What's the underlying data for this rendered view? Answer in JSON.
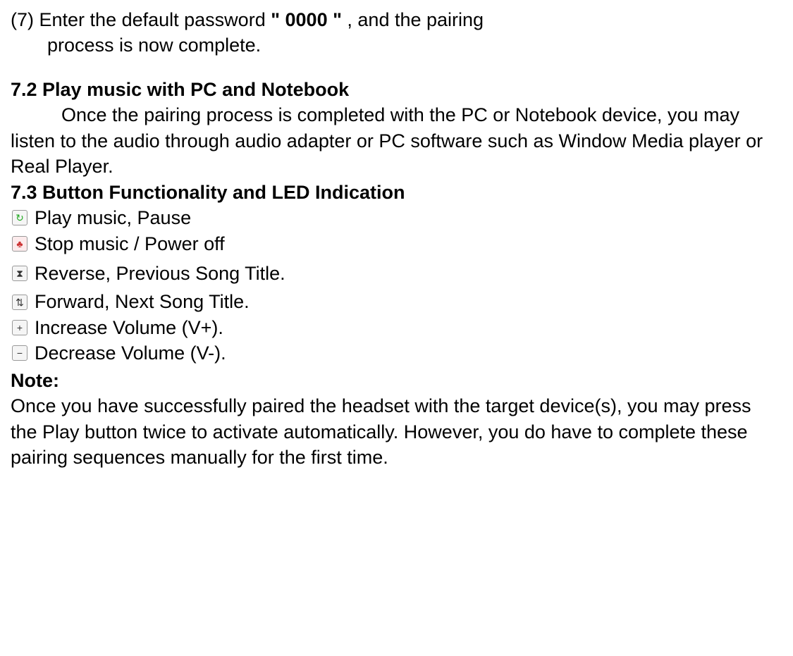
{
  "step7": {
    "num": "(7)",
    "line1_a": " Enter the default password ",
    "pw": "\" 0000 \"",
    "line1_b": ", and the pairing",
    "line2": "process is now complete."
  },
  "s72": {
    "heading": "7.2 Play music with PC and Notebook",
    "body": "Once the pairing process is completed with the PC or Notebook device, you may listen to the audio through audio adapter or PC software such as Window Media player or Real Player."
  },
  "s73": {
    "heading": "7.3   Button Functionality and LED Indication",
    "items": [
      {
        "icon_name": "play-pause-icon",
        "glyph": "↻",
        "label": "Play music, Pause"
      },
      {
        "icon_name": "stop-power-icon",
        "glyph": "♣",
        "label": "Stop music / Power off"
      },
      {
        "icon_name": "previous-icon",
        "glyph": "⧗",
        "label": "Reverse, Previous Song Title."
      },
      {
        "icon_name": "next-icon",
        "glyph": "⇅",
        "label": "Forward, Next Song Title."
      },
      {
        "icon_name": "vol-up-icon",
        "glyph": "+",
        "label": "Increase Volume (V+)."
      },
      {
        "icon_name": "vol-down-icon",
        "glyph": "−",
        "label": "Decrease Volume (V-)."
      }
    ]
  },
  "note": {
    "heading": "Note:",
    "body": "Once you have successfully paired the headset with the target device(s), you may press the Play button twice to activate automatically. However, you do have to complete these pairing sequences manually for the first time."
  }
}
